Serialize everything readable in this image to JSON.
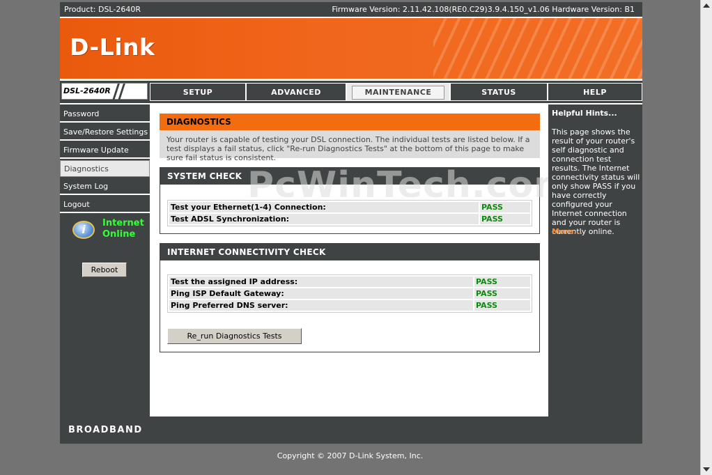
{
  "topbar": {
    "product": "Product: DSL-2640R",
    "firmware": "Firmware Version: 2.11.42.108(RE0.C29)3.9.4.150_v1.06 Hardware Version: B1"
  },
  "brand": {
    "logo": "D-Link",
    "model": "DSL-2640R",
    "banner_color": "#ea5a0d"
  },
  "tabs": [
    "SETUP",
    "ADVANCED",
    "MAINTENANCE",
    "STATUS",
    "HELP"
  ],
  "active_tab": "MAINTENANCE",
  "sidebar": {
    "items": [
      "Password",
      "Save/Restore Settings",
      "Firmware Update",
      "Diagnostics",
      "System Log",
      "Logout"
    ],
    "active": "Diagnostics",
    "status_line1": "Internet",
    "status_line2": "Online",
    "reboot_label": "Reboot"
  },
  "main": {
    "title": "DIAGNOSTICS",
    "description": "Your router is capable of testing your DSL connection. The individual tests are listed below. If a test displays a fail status, click \"Re-run Diagnostics Tests\" at the bottom of this page to make sure fail status is consistent.",
    "system_check": {
      "heading": "SYSTEM CHECK",
      "rows": [
        {
          "test": "Test your Ethernet(1-4) Connection:",
          "result": "PASS"
        },
        {
          "test": "Test ADSL Synchronization:",
          "result": "PASS"
        }
      ]
    },
    "internet_check": {
      "heading": "INTERNET CONNECTIVITY CHECK",
      "rows": [
        {
          "test": "Test the assigned IP address:",
          "result": "PASS"
        },
        {
          "test": "Ping ISP Default Gateway:",
          "result": "PASS"
        },
        {
          "test": "Ping Preferred DNS server:",
          "result": "PASS"
        }
      ]
    },
    "rerun_label": "Re_run Diagnostics Tests"
  },
  "hints": {
    "title": "Helpful Hints...",
    "text": "This page shows the result of your router's self diagnostic and connection test results. The Internet connectivity status will only show PASS if you have correctly configured your Internet connection and your router is currently online.",
    "more": "More..."
  },
  "watermark": "PcWinTech.com",
  "footer": {
    "broadband": "BROADBAND",
    "copyright": "Copyright © 2007 D-Link System, Inc."
  },
  "colors": {
    "pass": "#0b8a0b",
    "online": "#33ff33",
    "nav_dark": "#404343",
    "accent": "#f46c10"
  }
}
